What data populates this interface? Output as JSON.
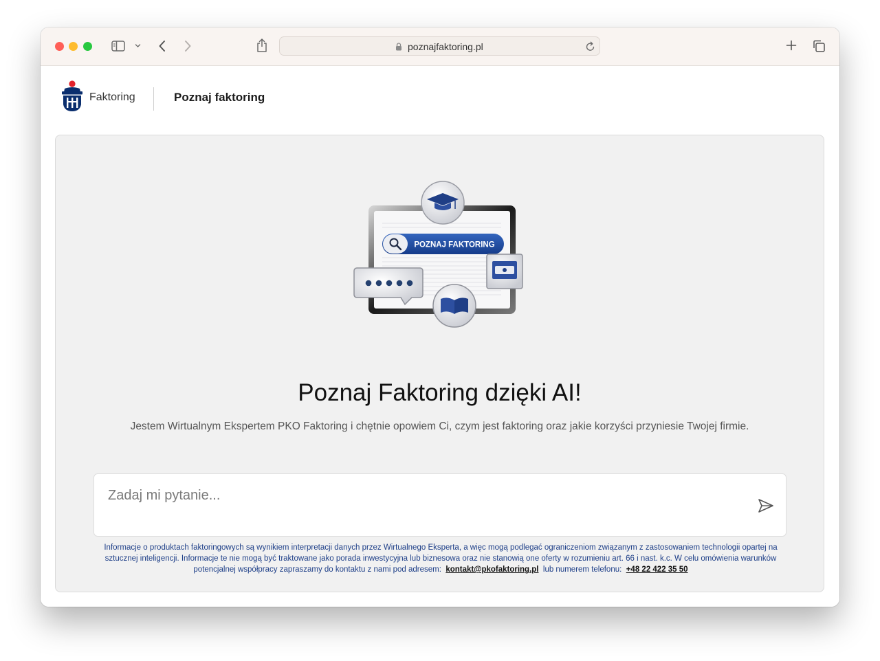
{
  "browser": {
    "url": "poznajfaktoring.pl",
    "icons": [
      "sidebar-icon",
      "chevron-down-icon",
      "back-arrow-icon",
      "forward-arrow-icon",
      "share-icon",
      "lock-icon",
      "reload-icon",
      "new-tab-icon",
      "tab-overview-icon"
    ]
  },
  "header": {
    "brand_name": "Faktoring",
    "nav_link": "Poznaj faktoring"
  },
  "hero": {
    "image_badge": "POZNAJ FAKTORING",
    "title": "Poznaj Faktoring dzięki AI!",
    "subtitle": "Jestem Wirtualnym Ekspertem PKO Faktoring i chętnie opowiem Ci, czym jest faktoring oraz jakie korzyści przyniesie Twojej firmie."
  },
  "chat": {
    "placeholder": "Zadaj mi pytanie...",
    "send_icon": "send-icon"
  },
  "disclaimer": {
    "text_before": "Informacje o produktach faktoringowych są wynikiem interpretacji danych przez Wirtualnego Eksperta, a więc mogą podlegać ograniczeniom związanym z zastosowaniem technologii opartej na sztucznej inteligencji. Informacje te nie mogą być traktowane jako porada inwestycyjna lub biznesowa oraz nie stanowią one oferty w rozumieniu art. 66 i nast. k.c. W celu omówienia warunków potencjalnej współpracy zapraszamy do kontaktu z nami pod adresem:",
    "email": "kontakt@pkofaktoring.pl",
    "text_middle": "lub numerem telefonu:",
    "phone": "+48 22 422 35 50"
  },
  "colors": {
    "brand_navy": "#0a2e6e",
    "brand_red": "#e3222b",
    "badge_blue": "#1f4fa7",
    "disclaimer_text": "#1e3f88",
    "panel_bg": "#f1f1f1"
  }
}
